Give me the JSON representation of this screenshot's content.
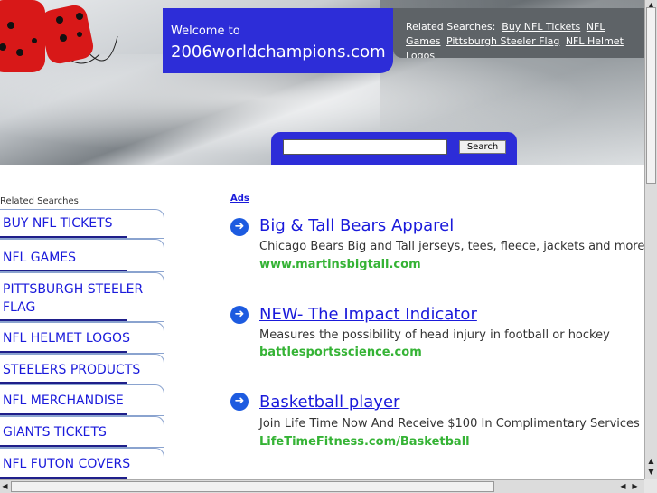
{
  "header": {
    "welcome_small": "Welcome to",
    "site_name": "2006worldchampions.com",
    "related_label": "Related Searches:",
    "related_links": [
      "Buy NFL Tickets",
      "NFL Games",
      "Pittsburgh Steeler Flag",
      "NFL Helmet Logos"
    ]
  },
  "search": {
    "button_label": "Search",
    "value": ""
  },
  "sidebar": {
    "label": "Related Searches",
    "items": [
      "BUY NFL TICKETS",
      "NFL GAMES",
      "PITTSBURGH STEELER FLAG",
      "NFL HELMET LOGOS",
      "STEELERS PRODUCTS",
      "NFL MERCHANDISE",
      "GIANTS TICKETS",
      "NFL FUTON COVERS"
    ]
  },
  "ads": {
    "label": "Ads",
    "items": [
      {
        "title": "Big & Tall Bears Apparel",
        "desc": "Chicago Bears Big and Tall jerseys, tees, fleece, jackets and more",
        "url": "www.martinsbigtall.com"
      },
      {
        "title": "NEW- The Impact Indicator",
        "desc": "Measures the possibility of head injury in football or hockey",
        "url": "battlesportsscience.com"
      },
      {
        "title": "Basketball player",
        "desc": "Join Life Time Now And Receive $100 In Complimentary Services",
        "url": "LifeTimeFitness.com/Basketball"
      }
    ]
  },
  "colors": {
    "header_blue": "#2d2dd8",
    "link_blue": "#1a1adb",
    "url_green": "#35b335",
    "dice_red": "#d81818"
  },
  "icons": {
    "ad_arrow": "arrow-right-circle-icon",
    "dice": "fuzzy-dice-icon"
  }
}
